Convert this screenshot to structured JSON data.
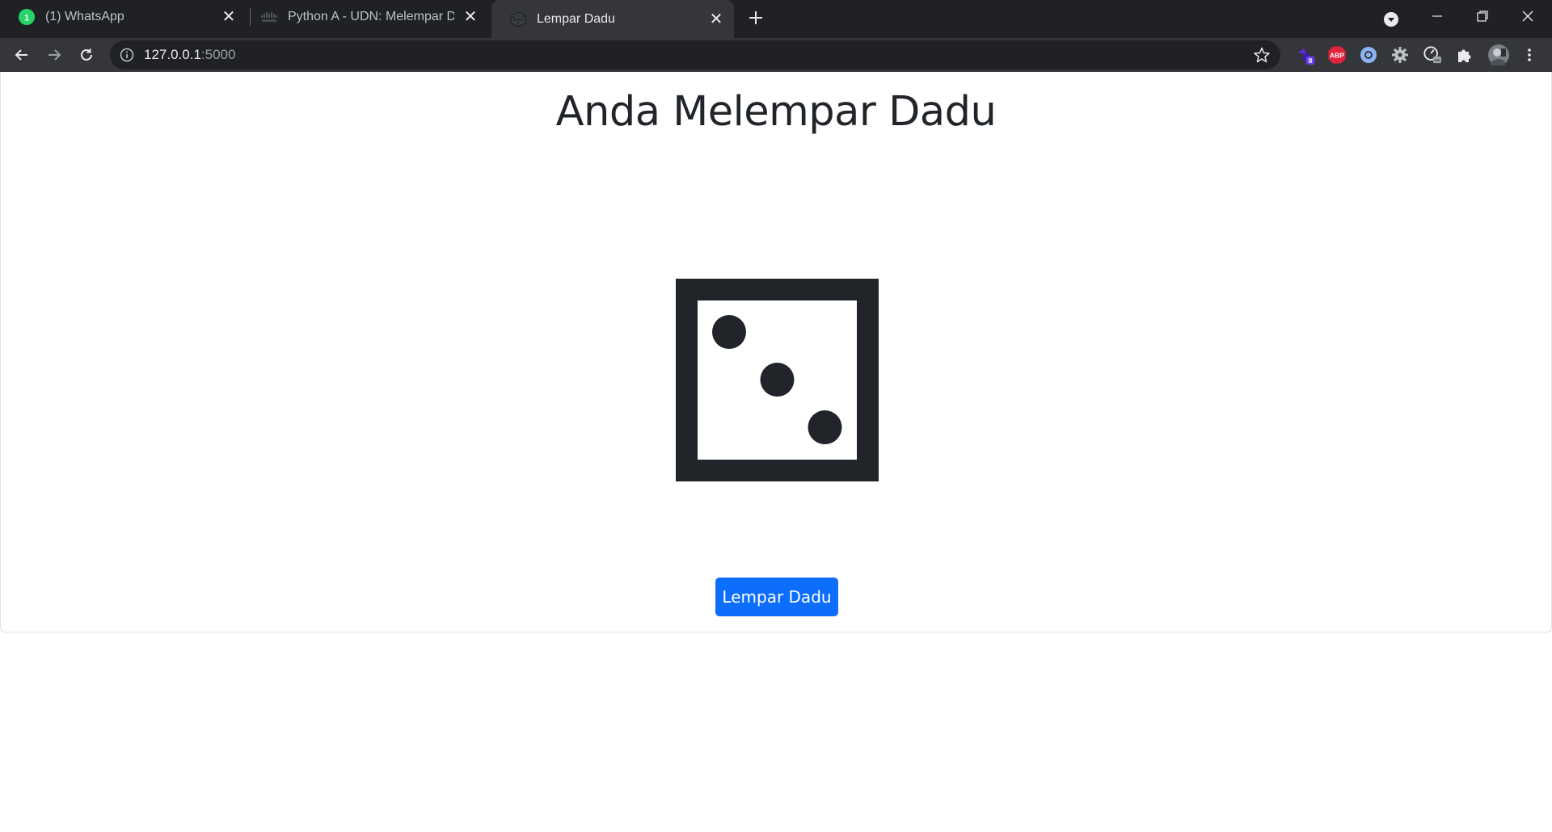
{
  "browser": {
    "tabs": [
      {
        "title": "(1) WhatsApp",
        "favicon": "whatsapp-icon",
        "active": false
      },
      {
        "title": "Python A - UDN: Melempar Dadu",
        "favicon": "cisco-icon",
        "active": false
      },
      {
        "title": "Lempar Dadu",
        "favicon": "dice-favicon-icon",
        "active": true
      }
    ],
    "address": {
      "host": "127.0.0.1",
      "port": ":5000"
    },
    "extensions": {
      "badge_count": "8",
      "abp_label": "ABP"
    }
  },
  "page": {
    "heading": "Anda Melempar Dadu",
    "dice": {
      "face_value": 3,
      "icon": "dice-three-icon"
    },
    "roll_button_label": "Lempar Dadu"
  },
  "colors": {
    "primary": "#0d6efd",
    "text": "#212529",
    "tab_bar": "#202124",
    "toolbar": "#35363a"
  }
}
